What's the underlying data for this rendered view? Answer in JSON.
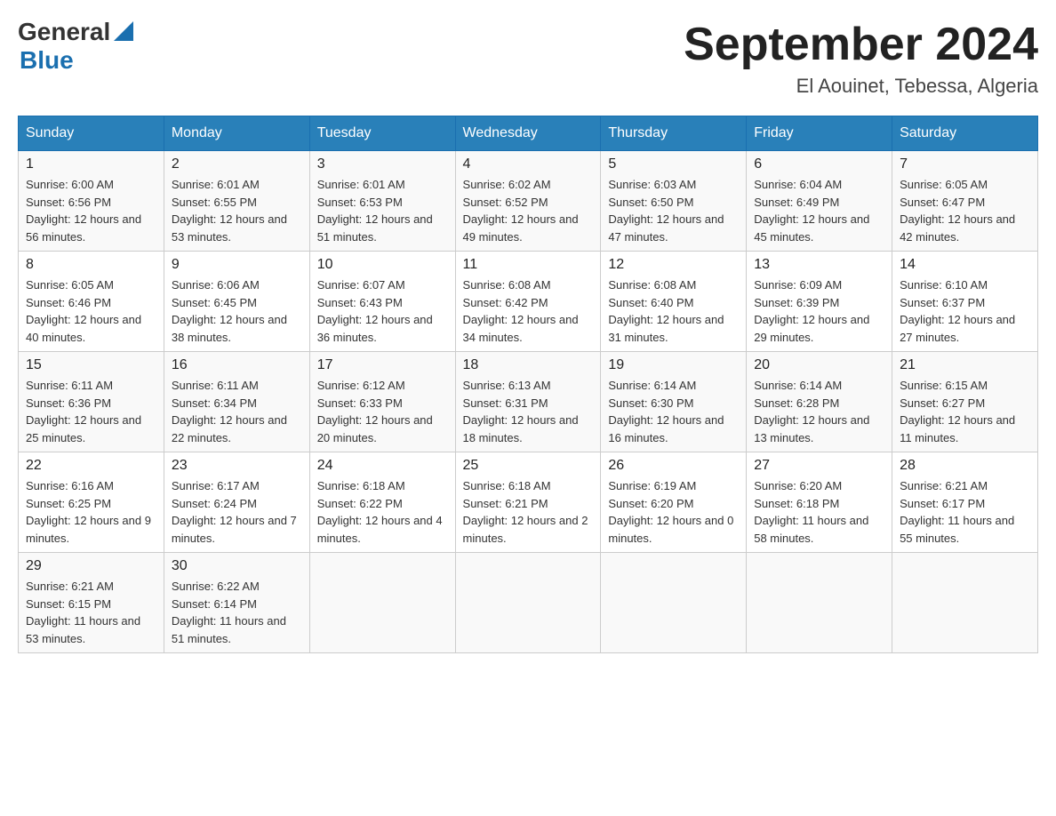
{
  "logo": {
    "general": "General",
    "blue": "Blue"
  },
  "title": "September 2024",
  "location": "El Aouinet, Tebessa, Algeria",
  "weekdays": [
    "Sunday",
    "Monday",
    "Tuesday",
    "Wednesday",
    "Thursday",
    "Friday",
    "Saturday"
  ],
  "weeks": [
    [
      {
        "day": "1",
        "sunrise": "6:00 AM",
        "sunset": "6:56 PM",
        "daylight": "12 hours and 56 minutes."
      },
      {
        "day": "2",
        "sunrise": "6:01 AM",
        "sunset": "6:55 PM",
        "daylight": "12 hours and 53 minutes."
      },
      {
        "day": "3",
        "sunrise": "6:01 AM",
        "sunset": "6:53 PM",
        "daylight": "12 hours and 51 minutes."
      },
      {
        "day": "4",
        "sunrise": "6:02 AM",
        "sunset": "6:52 PM",
        "daylight": "12 hours and 49 minutes."
      },
      {
        "day": "5",
        "sunrise": "6:03 AM",
        "sunset": "6:50 PM",
        "daylight": "12 hours and 47 minutes."
      },
      {
        "day": "6",
        "sunrise": "6:04 AM",
        "sunset": "6:49 PM",
        "daylight": "12 hours and 45 minutes."
      },
      {
        "day": "7",
        "sunrise": "6:05 AM",
        "sunset": "6:47 PM",
        "daylight": "12 hours and 42 minutes."
      }
    ],
    [
      {
        "day": "8",
        "sunrise": "6:05 AM",
        "sunset": "6:46 PM",
        "daylight": "12 hours and 40 minutes."
      },
      {
        "day": "9",
        "sunrise": "6:06 AM",
        "sunset": "6:45 PM",
        "daylight": "12 hours and 38 minutes."
      },
      {
        "day": "10",
        "sunrise": "6:07 AM",
        "sunset": "6:43 PM",
        "daylight": "12 hours and 36 minutes."
      },
      {
        "day": "11",
        "sunrise": "6:08 AM",
        "sunset": "6:42 PM",
        "daylight": "12 hours and 34 minutes."
      },
      {
        "day": "12",
        "sunrise": "6:08 AM",
        "sunset": "6:40 PM",
        "daylight": "12 hours and 31 minutes."
      },
      {
        "day": "13",
        "sunrise": "6:09 AM",
        "sunset": "6:39 PM",
        "daylight": "12 hours and 29 minutes."
      },
      {
        "day": "14",
        "sunrise": "6:10 AM",
        "sunset": "6:37 PM",
        "daylight": "12 hours and 27 minutes."
      }
    ],
    [
      {
        "day": "15",
        "sunrise": "6:11 AM",
        "sunset": "6:36 PM",
        "daylight": "12 hours and 25 minutes."
      },
      {
        "day": "16",
        "sunrise": "6:11 AM",
        "sunset": "6:34 PM",
        "daylight": "12 hours and 22 minutes."
      },
      {
        "day": "17",
        "sunrise": "6:12 AM",
        "sunset": "6:33 PM",
        "daylight": "12 hours and 20 minutes."
      },
      {
        "day": "18",
        "sunrise": "6:13 AM",
        "sunset": "6:31 PM",
        "daylight": "12 hours and 18 minutes."
      },
      {
        "day": "19",
        "sunrise": "6:14 AM",
        "sunset": "6:30 PM",
        "daylight": "12 hours and 16 minutes."
      },
      {
        "day": "20",
        "sunrise": "6:14 AM",
        "sunset": "6:28 PM",
        "daylight": "12 hours and 13 minutes."
      },
      {
        "day": "21",
        "sunrise": "6:15 AM",
        "sunset": "6:27 PM",
        "daylight": "12 hours and 11 minutes."
      }
    ],
    [
      {
        "day": "22",
        "sunrise": "6:16 AM",
        "sunset": "6:25 PM",
        "daylight": "12 hours and 9 minutes."
      },
      {
        "day": "23",
        "sunrise": "6:17 AM",
        "sunset": "6:24 PM",
        "daylight": "12 hours and 7 minutes."
      },
      {
        "day": "24",
        "sunrise": "6:18 AM",
        "sunset": "6:22 PM",
        "daylight": "12 hours and 4 minutes."
      },
      {
        "day": "25",
        "sunrise": "6:18 AM",
        "sunset": "6:21 PM",
        "daylight": "12 hours and 2 minutes."
      },
      {
        "day": "26",
        "sunrise": "6:19 AM",
        "sunset": "6:20 PM",
        "daylight": "12 hours and 0 minutes."
      },
      {
        "day": "27",
        "sunrise": "6:20 AM",
        "sunset": "6:18 PM",
        "daylight": "11 hours and 58 minutes."
      },
      {
        "day": "28",
        "sunrise": "6:21 AM",
        "sunset": "6:17 PM",
        "daylight": "11 hours and 55 minutes."
      }
    ],
    [
      {
        "day": "29",
        "sunrise": "6:21 AM",
        "sunset": "6:15 PM",
        "daylight": "11 hours and 53 minutes."
      },
      {
        "day": "30",
        "sunrise": "6:22 AM",
        "sunset": "6:14 PM",
        "daylight": "11 hours and 51 minutes."
      },
      null,
      null,
      null,
      null,
      null
    ]
  ],
  "labels": {
    "sunrise": "Sunrise:",
    "sunset": "Sunset:",
    "daylight": "Daylight:"
  }
}
